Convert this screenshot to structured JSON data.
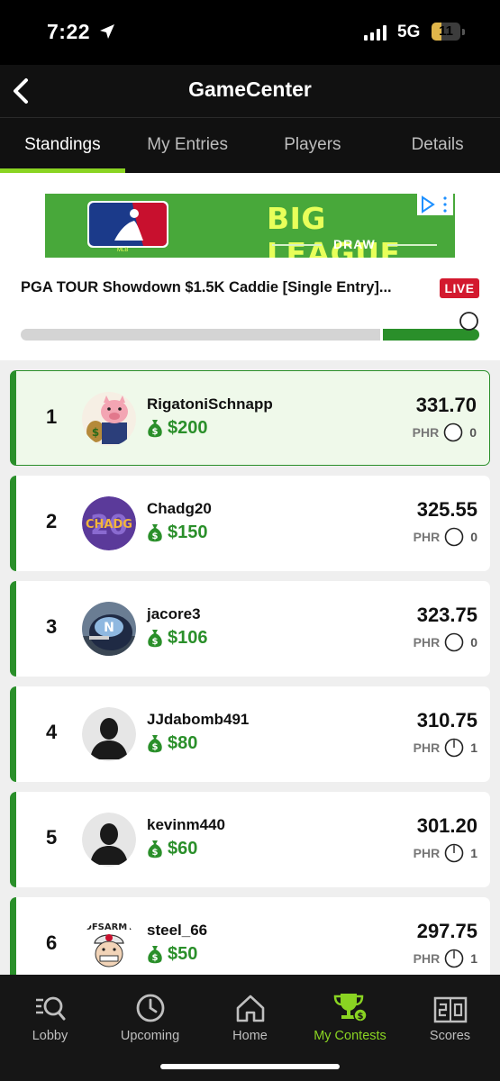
{
  "status_bar": {
    "time": "7:22",
    "network": "5G",
    "battery": "11"
  },
  "header": {
    "title": "GameCenter"
  },
  "tabs": [
    {
      "label": "Standings",
      "active": true
    },
    {
      "label": "My Entries",
      "active": false
    },
    {
      "label": "Players",
      "active": false
    },
    {
      "label": "Details",
      "active": false
    }
  ],
  "ad": {
    "logo_caption": "MLB",
    "title": "BIG LEAGUE",
    "subtitle": "DRAW"
  },
  "contest": {
    "title": "PGA TOUR Showdown $1.5K Caddie [Single Entry]...",
    "live_label": "LIVE",
    "progress_completed": 0.21
  },
  "standings": [
    {
      "rank": "1",
      "username": "RigatoniSchnapp",
      "prize": "$200",
      "score": "331.70",
      "phr_label": "PHR",
      "phr": "0",
      "avatar": "pig-avatar",
      "highlight": true
    },
    {
      "rank": "2",
      "username": "Chadg20",
      "prize": "$150",
      "score": "325.55",
      "phr_label": "PHR",
      "phr": "0",
      "avatar": "chadg-avatar",
      "highlight": false
    },
    {
      "rank": "3",
      "username": "jacore3",
      "prize": "$106",
      "score": "323.75",
      "phr_label": "PHR",
      "phr": "0",
      "avatar": "helmet-avatar",
      "highlight": false
    },
    {
      "rank": "4",
      "username": "JJdabomb491",
      "prize": "$80",
      "score": "310.75",
      "phr_label": "PHR",
      "phr": "1",
      "avatar": "default-avatar",
      "highlight": false
    },
    {
      "rank": "5",
      "username": "kevinm440",
      "prize": "$60",
      "score": "301.20",
      "phr_label": "PHR",
      "phr": "1",
      "avatar": "default-avatar",
      "highlight": false
    },
    {
      "rank": "6",
      "username": "steel_66",
      "prize": "$50",
      "score": "297.75",
      "phr_label": "PHR",
      "phr": "1",
      "avatar": "dfsarmy-avatar",
      "highlight": false
    }
  ],
  "avatar_texts": {
    "chadg": "CHADG",
    "chadg_number": "20",
    "dfsarmy": "DFSARMY"
  },
  "bottom_nav": [
    {
      "label": "Lobby",
      "icon": "lobby-search-icon",
      "active": false
    },
    {
      "label": "Upcoming",
      "icon": "clock-icon",
      "active": false
    },
    {
      "label": "Home",
      "icon": "home-icon",
      "active": false
    },
    {
      "label": "My Contests",
      "icon": "trophy-icon",
      "active": true
    },
    {
      "label": "Scores",
      "icon": "scoreboard-icon",
      "active": false
    }
  ],
  "colors": {
    "accent_green": "#8ad422",
    "money_green": "#2a8f2a",
    "live_red": "#d3192e",
    "header_bg": "#111111"
  }
}
